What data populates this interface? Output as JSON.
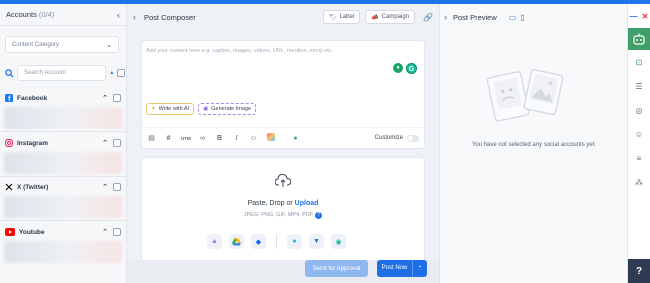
{
  "accounts": {
    "title": "Accounts",
    "count": "(0/4)",
    "category_placeholder": "Content Category",
    "search_placeholder": "Search Account",
    "networks": [
      {
        "name": "Facebook",
        "icon": "facebook-icon",
        "color": "#1877f2"
      },
      {
        "name": "Instagram",
        "icon": "instagram-icon",
        "color": "#e1306c"
      },
      {
        "name": "X (Twitter)",
        "icon": "x-icon",
        "color": "#111111"
      },
      {
        "name": "Youtube",
        "icon": "youtube-icon",
        "color": "#ff0000"
      }
    ]
  },
  "composer": {
    "title": "Post Composer",
    "label_button": "Label",
    "campaign_button": "Campaign",
    "editor_placeholder": "Add your content here e.g. caption, images, videos, URL, mention, emoji etc.",
    "write_ai": "Write with AI",
    "generate_image": "Generate Image",
    "customize": "Customize",
    "upload_prefix": "Paste, Drop or ",
    "upload_link": "Upload",
    "upload_formats": "JPEG, PNG, GIF, MP4, PDF",
    "send_approval": "Send for Approval",
    "post_now": "Post Now"
  },
  "preview": {
    "title": "Post Preview",
    "empty_message": "You have not selected any social accounts yet."
  },
  "colors": {
    "accent": "#1e74e8",
    "post_button": "#1e6fe6",
    "approval_button": "#8fb8f1"
  }
}
